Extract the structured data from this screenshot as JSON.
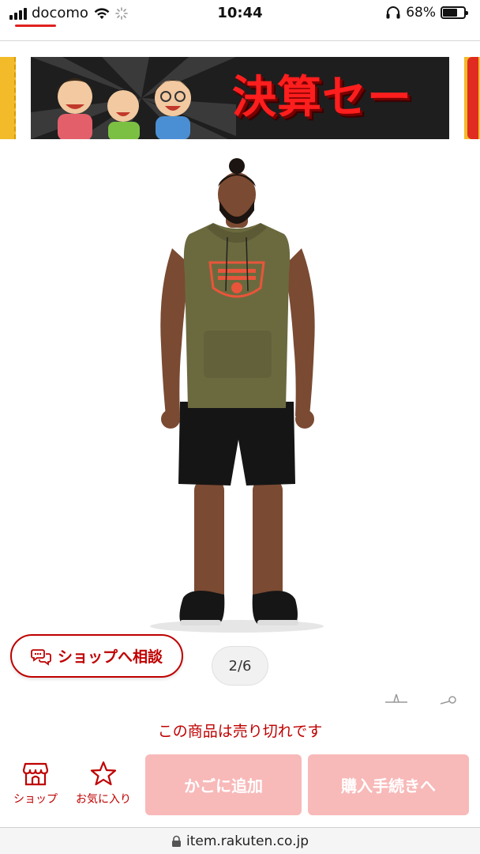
{
  "status_bar": {
    "carrier": "docomo",
    "time": "10:44",
    "battery_percent": "68%",
    "battery_level": 0.68
  },
  "banner": {
    "text": "決算セール"
  },
  "gallery": {
    "counter": "2/6"
  },
  "consult_button": {
    "label": "ショップへ相談"
  },
  "stock_notice": "この商品は売り切れです",
  "bottom_nav": {
    "shop_label": "ショップ",
    "favorite_label": "お気に入り"
  },
  "actions": {
    "cart_label": "かごに追加",
    "buy_label": "購入手続きへ"
  },
  "browser": {
    "url": "item.rakuten.co.jp"
  },
  "colors": {
    "brand_red": "#bf0000",
    "disabled_button": "#f8b9b9"
  }
}
